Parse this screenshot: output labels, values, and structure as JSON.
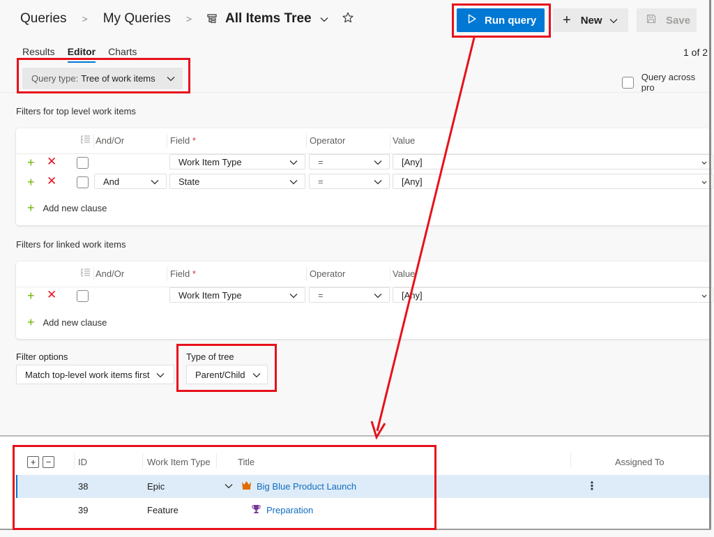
{
  "header": {
    "breadcrumb": [
      "Queries",
      "My Queries"
    ],
    "query_title": "All Items Tree",
    "run_query_label": "Run query",
    "new_label": "New",
    "save_label": "Save",
    "icons": {
      "query": "tree-query-icon",
      "star": "star-outline-icon",
      "run": "play-icon",
      "save": "floppy-disk-icon"
    }
  },
  "tabs": [
    {
      "label": "Results",
      "active": false
    },
    {
      "label": "Editor",
      "active": true
    },
    {
      "label": "Charts",
      "active": false
    }
  ],
  "pager": "1 of 2",
  "query_type": {
    "label": "Query type:",
    "value": "Tree of work items"
  },
  "query_across_projects": {
    "label": "Query across pro",
    "checked": false
  },
  "top_level_filters": {
    "title": "Filters for top level work items",
    "columns": {
      "andor": "And/Or",
      "field": "Field",
      "required_marker": "*",
      "operator": "Operator",
      "value": "Value"
    },
    "clauses": [
      {
        "andor": "",
        "field": "Work Item Type",
        "operator": "=",
        "value": "[Any]"
      },
      {
        "andor": "And",
        "field": "State",
        "operator": "=",
        "value": "[Any]"
      }
    ],
    "add_clause_label": "Add new clause"
  },
  "linked_filters": {
    "title": "Filters for linked work items",
    "columns": {
      "andor": "And/Or",
      "field": "Field",
      "required_marker": "*",
      "operator": "Operator",
      "value": "Value"
    },
    "clauses": [
      {
        "andor": "",
        "field": "Work Item Type",
        "operator": "=",
        "value": "[Any]"
      }
    ],
    "add_clause_label": "Add new clause"
  },
  "filter_options": {
    "label": "Filter options",
    "value": "Match top-level work items first"
  },
  "type_of_tree": {
    "label": "Type of tree",
    "value": "Parent/Child"
  },
  "results": {
    "expand_all": "+",
    "collapse_all": "−",
    "columns": [
      "ID",
      "Work Item Type",
      "Title",
      "Assigned To"
    ],
    "rows": [
      {
        "id": "38",
        "type": "Epic",
        "title": "Big Blue Product Launch",
        "icon": "crown-icon",
        "icon_color": "#e06c00",
        "expanded": true,
        "selected": true
      },
      {
        "id": "39",
        "type": "Feature",
        "title": "Preparation",
        "icon": "trophy-icon",
        "icon_color": "#773b93",
        "expanded": false,
        "selected": false
      }
    ]
  },
  "colors": {
    "accent": "#0078d4",
    "annotation": "#e8101a",
    "add": "#6bb700",
    "delete": "#e81123",
    "selected_row": "#deecf9"
  }
}
